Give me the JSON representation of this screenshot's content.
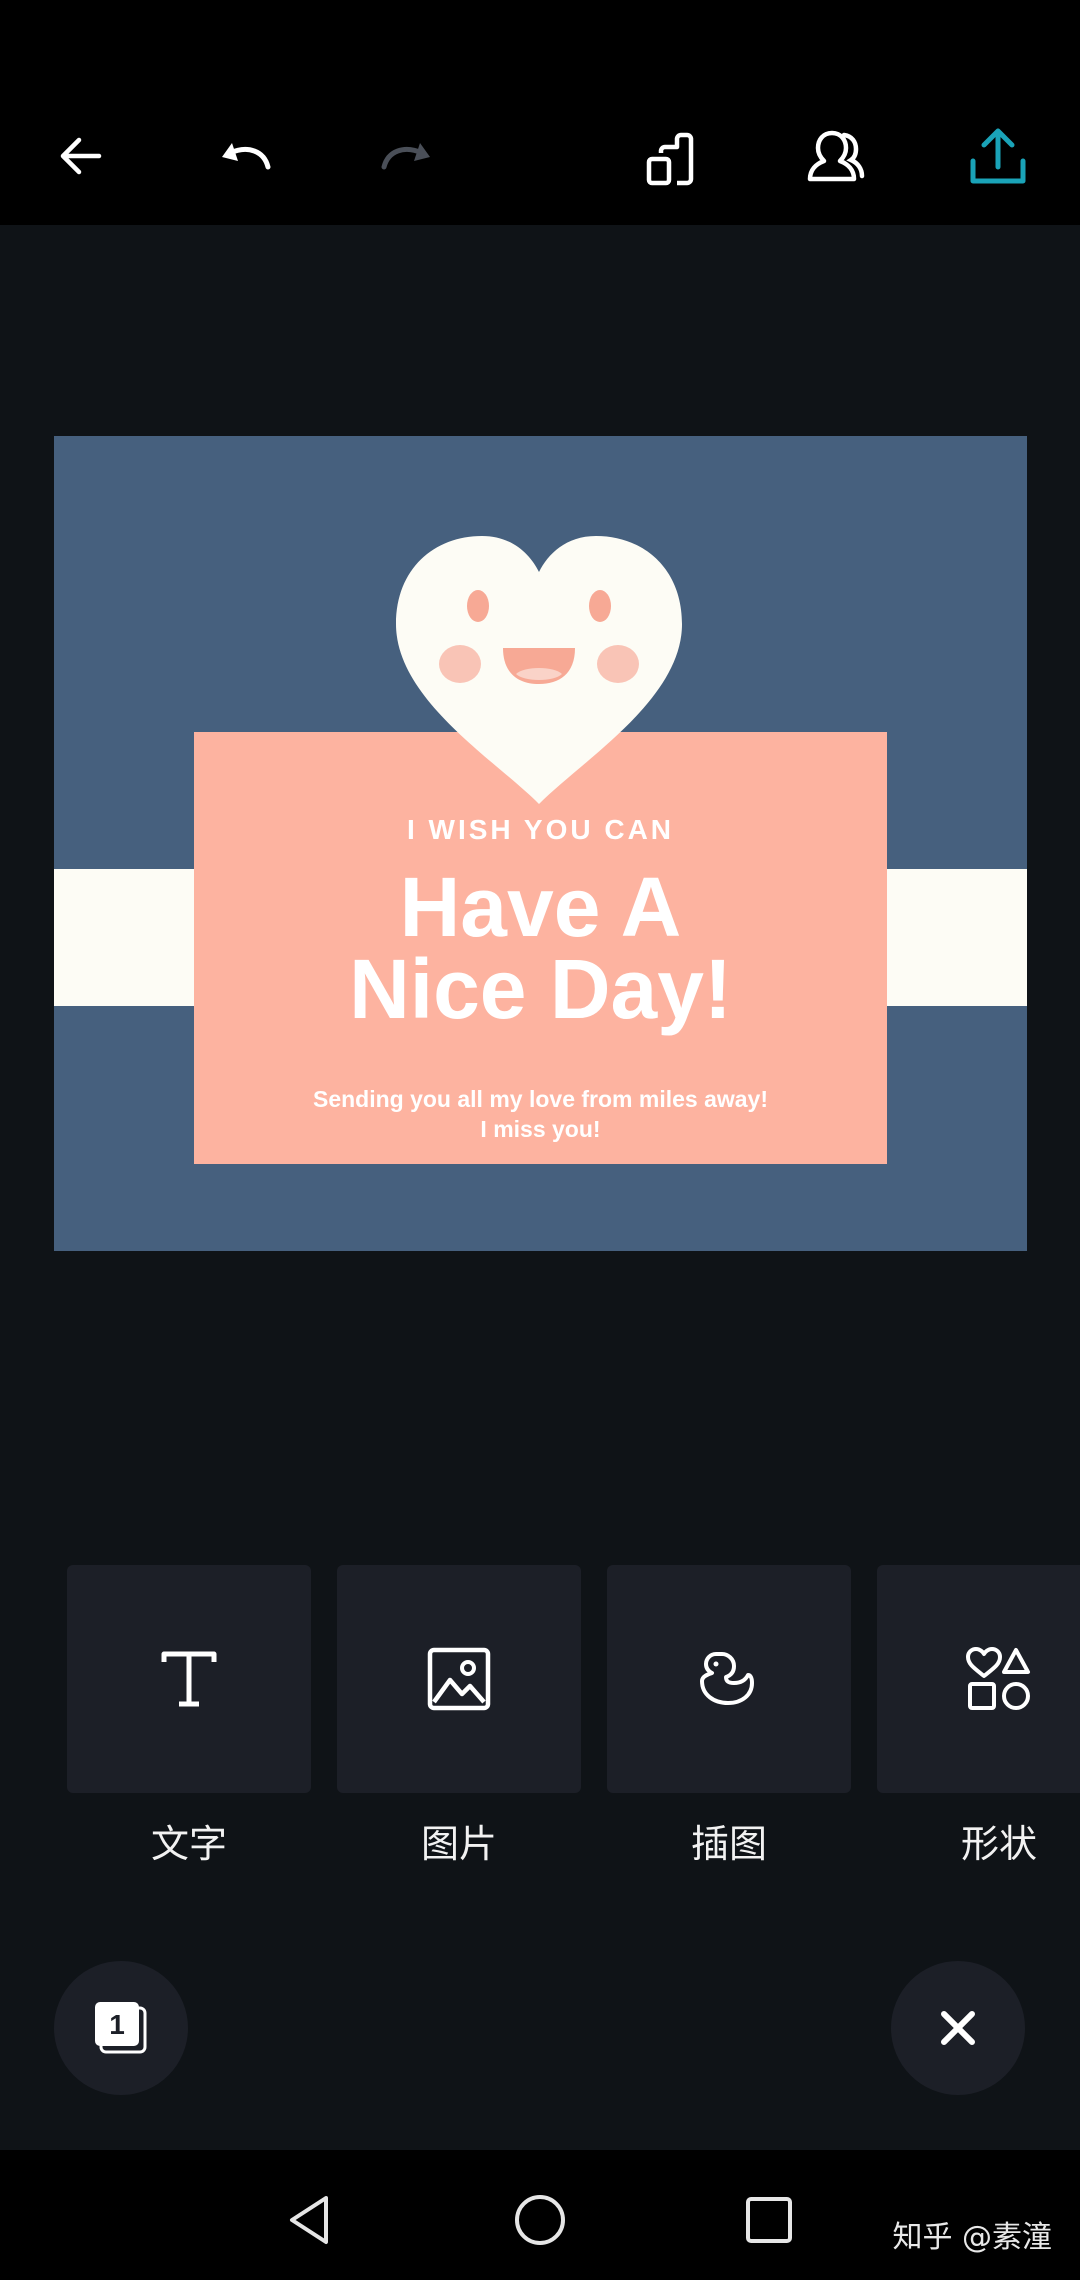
{
  "toolbar": {
    "back_icon": "back-arrow-icon",
    "undo_icon": "undo-icon",
    "redo_icon": "redo-icon",
    "resize_icon": "resize-icon",
    "share_people_icon": "collaborators-icon",
    "export_icon": "export-icon",
    "accent": "#1aa3b8"
  },
  "card": {
    "subtitle": "I WISH YOU CAN",
    "title_line1": "Have A",
    "title_line2": "Nice Day!",
    "message_line1": "Sending you all my love from miles away!",
    "message_line2": "I miss you!",
    "colors": {
      "background": "#46607e",
      "band": "#fdfcf5",
      "box": "#fdb3a0",
      "heart": "#fdfcf5"
    }
  },
  "tools": [
    {
      "label": "文字",
      "icon": "text-icon"
    },
    {
      "label": "图片",
      "icon": "image-icon"
    },
    {
      "label": "插图",
      "icon": "illustration-duck-icon"
    },
    {
      "label": "形状",
      "icon": "shapes-icon"
    }
  ],
  "pages": {
    "count": "1"
  },
  "close_icon": "close-icon",
  "system_nav": {
    "back_icon": "nav-back-icon",
    "home_icon": "nav-home-icon",
    "recents_icon": "nav-recents-icon"
  },
  "watermark": "知乎 @素潼"
}
